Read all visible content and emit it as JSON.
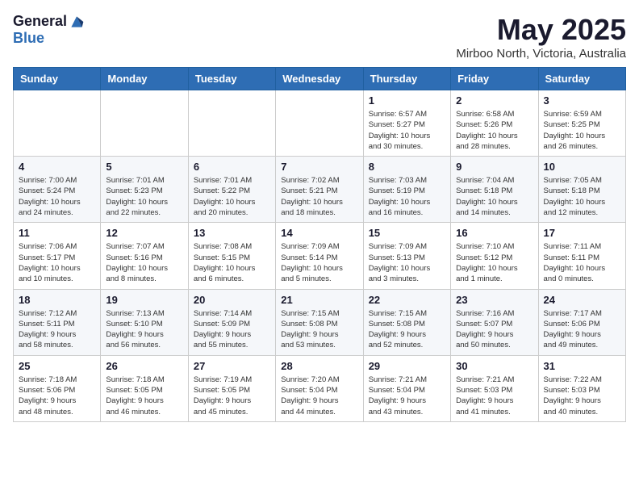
{
  "header": {
    "logo_general": "General",
    "logo_blue": "Blue",
    "month_title": "May 2025",
    "subtitle": "Mirboo North, Victoria, Australia"
  },
  "weekdays": [
    "Sunday",
    "Monday",
    "Tuesday",
    "Wednesday",
    "Thursday",
    "Friday",
    "Saturday"
  ],
  "weeks": [
    [
      {
        "day": "",
        "info": ""
      },
      {
        "day": "",
        "info": ""
      },
      {
        "day": "",
        "info": ""
      },
      {
        "day": "",
        "info": ""
      },
      {
        "day": "1",
        "info": "Sunrise: 6:57 AM\nSunset: 5:27 PM\nDaylight: 10 hours\nand 30 minutes."
      },
      {
        "day": "2",
        "info": "Sunrise: 6:58 AM\nSunset: 5:26 PM\nDaylight: 10 hours\nand 28 minutes."
      },
      {
        "day": "3",
        "info": "Sunrise: 6:59 AM\nSunset: 5:25 PM\nDaylight: 10 hours\nand 26 minutes."
      }
    ],
    [
      {
        "day": "4",
        "info": "Sunrise: 7:00 AM\nSunset: 5:24 PM\nDaylight: 10 hours\nand 24 minutes."
      },
      {
        "day": "5",
        "info": "Sunrise: 7:01 AM\nSunset: 5:23 PM\nDaylight: 10 hours\nand 22 minutes."
      },
      {
        "day": "6",
        "info": "Sunrise: 7:01 AM\nSunset: 5:22 PM\nDaylight: 10 hours\nand 20 minutes."
      },
      {
        "day": "7",
        "info": "Sunrise: 7:02 AM\nSunset: 5:21 PM\nDaylight: 10 hours\nand 18 minutes."
      },
      {
        "day": "8",
        "info": "Sunrise: 7:03 AM\nSunset: 5:19 PM\nDaylight: 10 hours\nand 16 minutes."
      },
      {
        "day": "9",
        "info": "Sunrise: 7:04 AM\nSunset: 5:18 PM\nDaylight: 10 hours\nand 14 minutes."
      },
      {
        "day": "10",
        "info": "Sunrise: 7:05 AM\nSunset: 5:18 PM\nDaylight: 10 hours\nand 12 minutes."
      }
    ],
    [
      {
        "day": "11",
        "info": "Sunrise: 7:06 AM\nSunset: 5:17 PM\nDaylight: 10 hours\nand 10 minutes."
      },
      {
        "day": "12",
        "info": "Sunrise: 7:07 AM\nSunset: 5:16 PM\nDaylight: 10 hours\nand 8 minutes."
      },
      {
        "day": "13",
        "info": "Sunrise: 7:08 AM\nSunset: 5:15 PM\nDaylight: 10 hours\nand 6 minutes."
      },
      {
        "day": "14",
        "info": "Sunrise: 7:09 AM\nSunset: 5:14 PM\nDaylight: 10 hours\nand 5 minutes."
      },
      {
        "day": "15",
        "info": "Sunrise: 7:09 AM\nSunset: 5:13 PM\nDaylight: 10 hours\nand 3 minutes."
      },
      {
        "day": "16",
        "info": "Sunrise: 7:10 AM\nSunset: 5:12 PM\nDaylight: 10 hours\nand 1 minute."
      },
      {
        "day": "17",
        "info": "Sunrise: 7:11 AM\nSunset: 5:11 PM\nDaylight: 10 hours\nand 0 minutes."
      }
    ],
    [
      {
        "day": "18",
        "info": "Sunrise: 7:12 AM\nSunset: 5:11 PM\nDaylight: 9 hours\nand 58 minutes."
      },
      {
        "day": "19",
        "info": "Sunrise: 7:13 AM\nSunset: 5:10 PM\nDaylight: 9 hours\nand 56 minutes."
      },
      {
        "day": "20",
        "info": "Sunrise: 7:14 AM\nSunset: 5:09 PM\nDaylight: 9 hours\nand 55 minutes."
      },
      {
        "day": "21",
        "info": "Sunrise: 7:15 AM\nSunset: 5:08 PM\nDaylight: 9 hours\nand 53 minutes."
      },
      {
        "day": "22",
        "info": "Sunrise: 7:15 AM\nSunset: 5:08 PM\nDaylight: 9 hours\nand 52 minutes."
      },
      {
        "day": "23",
        "info": "Sunrise: 7:16 AM\nSunset: 5:07 PM\nDaylight: 9 hours\nand 50 minutes."
      },
      {
        "day": "24",
        "info": "Sunrise: 7:17 AM\nSunset: 5:06 PM\nDaylight: 9 hours\nand 49 minutes."
      }
    ],
    [
      {
        "day": "25",
        "info": "Sunrise: 7:18 AM\nSunset: 5:06 PM\nDaylight: 9 hours\nand 48 minutes."
      },
      {
        "day": "26",
        "info": "Sunrise: 7:18 AM\nSunset: 5:05 PM\nDaylight: 9 hours\nand 46 minutes."
      },
      {
        "day": "27",
        "info": "Sunrise: 7:19 AM\nSunset: 5:05 PM\nDaylight: 9 hours\nand 45 minutes."
      },
      {
        "day": "28",
        "info": "Sunrise: 7:20 AM\nSunset: 5:04 PM\nDaylight: 9 hours\nand 44 minutes."
      },
      {
        "day": "29",
        "info": "Sunrise: 7:21 AM\nSunset: 5:04 PM\nDaylight: 9 hours\nand 43 minutes."
      },
      {
        "day": "30",
        "info": "Sunrise: 7:21 AM\nSunset: 5:03 PM\nDaylight: 9 hours\nand 41 minutes."
      },
      {
        "day": "31",
        "info": "Sunrise: 7:22 AM\nSunset: 5:03 PM\nDaylight: 9 hours\nand 40 minutes."
      }
    ]
  ]
}
